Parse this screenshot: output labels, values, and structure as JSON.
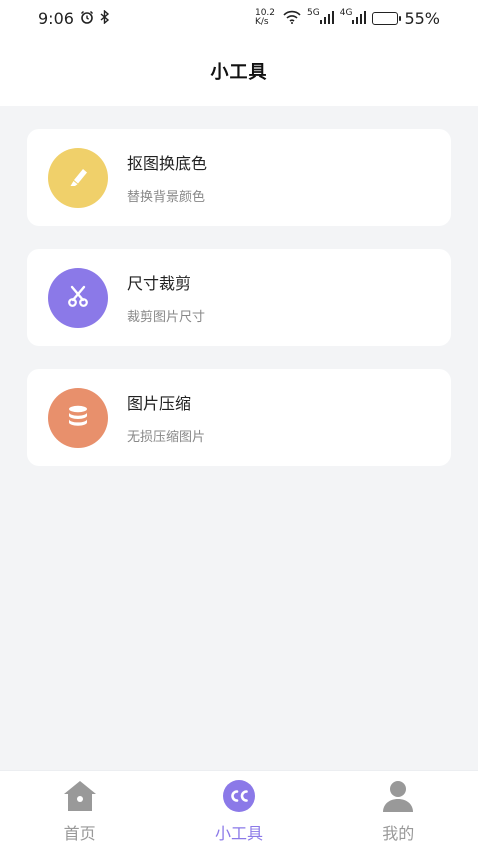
{
  "status_bar": {
    "time": "9:06",
    "net_speed_value": "10.2",
    "net_speed_unit": "K/s",
    "signal_1_label": "5G",
    "signal_2_label": "4G",
    "battery": "55%",
    "battery_level": 0.55
  },
  "header": {
    "title": "小工具"
  },
  "tools": [
    {
      "name": "抠图换底色",
      "desc": "替换背景颜色",
      "icon": "highlighter-icon",
      "color": "#f0d06a"
    },
    {
      "name": "尺寸裁剪",
      "desc": "裁剪图片尺寸",
      "icon": "scissors-icon",
      "color": "#8b79e8"
    },
    {
      "name": "图片压缩",
      "desc": "无损压缩图片",
      "icon": "database-icon",
      "color": "#e8906c"
    }
  ],
  "tabbar": {
    "tabs": [
      {
        "label": "首页",
        "icon": "home-icon",
        "active": false
      },
      {
        "label": "小工具",
        "icon": "cc-icon",
        "active": true
      },
      {
        "label": "我的",
        "icon": "user-icon",
        "active": false
      }
    ],
    "active_color": "#8b79e8",
    "inactive_color": "#999999"
  }
}
